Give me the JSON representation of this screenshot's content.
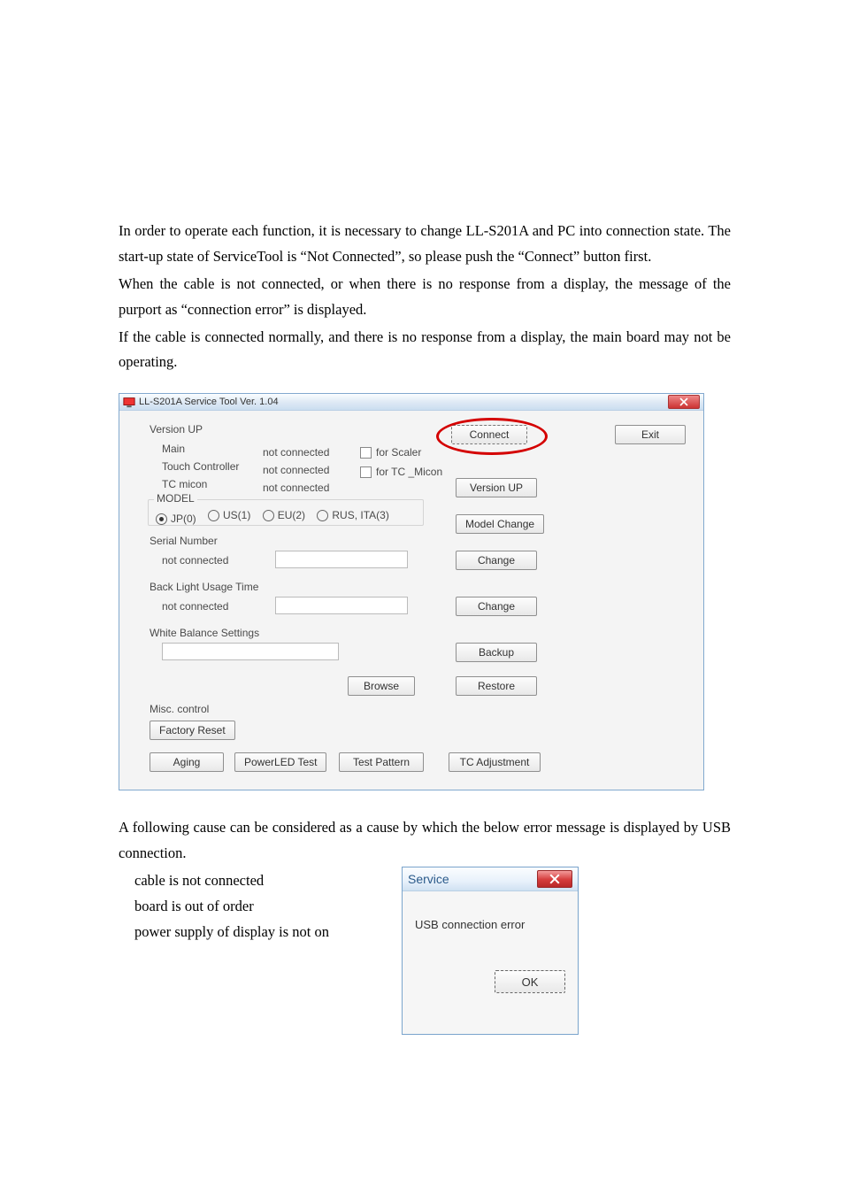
{
  "body_text": {
    "p1": "In order to operate each function, it is necessary to change LL-S201A and PC into connection state. The start-up state of ServiceTool is “Not Connected”, so please push the “Connect” button first.",
    "p2": "When the cable is not connected, or when there is no response from a display, the message of the purport as “connection error” is displayed.",
    "p3": "If the cable is connected normally, and there is no response from a display, the main board may not be operating.",
    "p4": "A following cause can be considered as a cause by which the below error message is displayed by USB connection.",
    "cause1": "cable is not connected",
    "cause2": "board is out of order",
    "cause3": "power supply of display is not on"
  },
  "win1": {
    "title": "LL-S201A Service Tool  Ver. 1.04",
    "connect": "Connect",
    "exit": "Exit",
    "section_version": "Version UP",
    "main": "Main",
    "touch_controller": "Touch Controller",
    "tc_micon": "TC micon",
    "not_connected": "not connected",
    "for_scaler": "for Scaler",
    "for_tc_micon": "for TC _Micon",
    "btn_version_up": "Version UP",
    "model_group": "MODEL",
    "model_jp": "JP(0)",
    "model_us": "US(1)",
    "model_eu": "EU(2)",
    "model_rus": "RUS, ITA(3)",
    "btn_model_change": "Model Change",
    "serial_label": "Serial Number",
    "btn_change": "Change",
    "backlight_label": "Back Light Usage Time",
    "wb_label": "White Balance Settings",
    "btn_backup": "Backup",
    "btn_browse": "Browse",
    "btn_restore": "Restore",
    "misc": "Misc. control",
    "factory_reset": "Factory Reset",
    "aging": "Aging",
    "powerled": "PowerLED Test",
    "test_pattern": "Test Pattern",
    "tc_adjust": "TC Adjustment"
  },
  "win2": {
    "title": "Service",
    "message": "USB connection error",
    "ok": "OK"
  }
}
